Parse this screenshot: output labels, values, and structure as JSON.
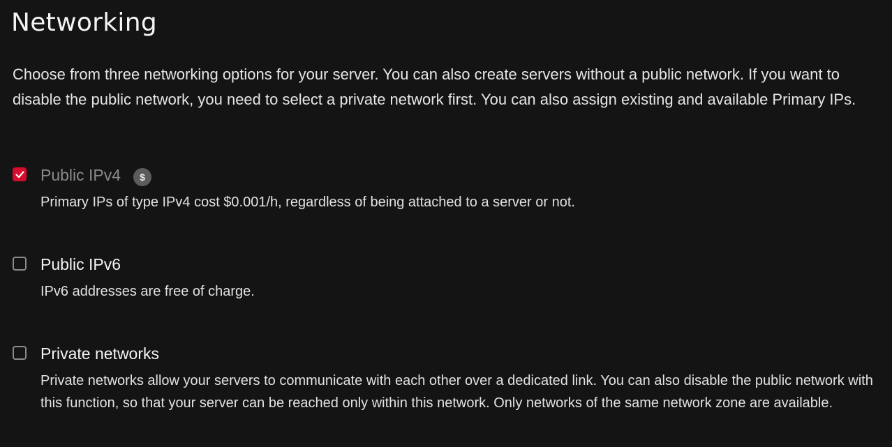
{
  "section": {
    "title": "Networking",
    "description": "Choose from three networking options for your server. You can also create servers without a public network. If you want to disable the public network, you need to select a private network first. You can also assign existing and available Primary IPs."
  },
  "options": [
    {
      "label": "Public IPv4",
      "checked": true,
      "badge": "$",
      "badge_icon": "dollar-cost-icon",
      "description": "Primary IPs of type IPv4 cost $0.001/h, regardless of being attached to a server or not."
    },
    {
      "label": "Public IPv6",
      "checked": false,
      "description": "IPv6 addresses are free of charge."
    },
    {
      "label": "Private networks",
      "checked": false,
      "description": "Private networks allow your servers to communicate with each other over a dedicated link. You can also disable the public network with this function, so that your server can be reached only within this network. Only networks of the same network zone are available."
    }
  ],
  "colors": {
    "background": "#141414",
    "accent": "#d50c2d",
    "muted_label": "#8a8a8a",
    "badge_bg": "#5c5c5c"
  }
}
